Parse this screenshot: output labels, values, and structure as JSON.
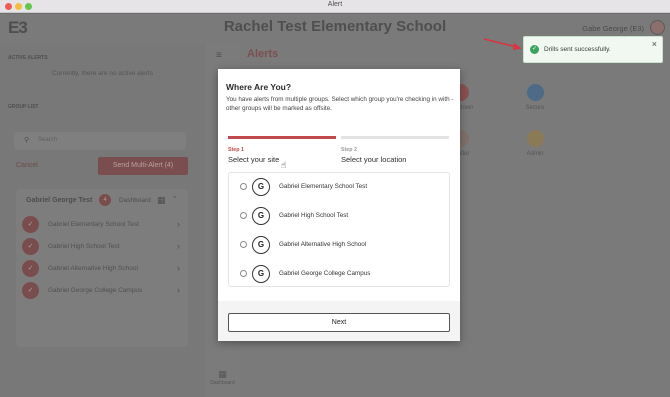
{
  "window": {
    "title": "Alert"
  },
  "header": {
    "logo": "E3",
    "school_name": "Rachel Test Elementary School",
    "user_name": "Gabe George (E3)"
  },
  "sidebar": {
    "active_alerts_title": "ACTIVE ALERTS",
    "no_alerts_text": "Currently, there are no active alerts",
    "group_list_title": "GROUP LIST",
    "search_placeholder": "Search",
    "cancel_label": "Cancel",
    "multi_alert_label": "Send Multi-Alert (4)",
    "group": {
      "name": "Gabriel George Test",
      "count": "4",
      "dashboard_label": "Dashboard",
      "items": [
        "Gabriel Elementary School Test",
        "Gabriel High School Test",
        "Gabriel Alternative High School",
        "Gabriel George College Campus"
      ]
    }
  },
  "main": {
    "alerts_title": "Alerts",
    "quick_actions": [
      "Lockdown",
      "Secure",
      "Shelter",
      "Admin"
    ],
    "dashboard_label": "Dashboard"
  },
  "modal": {
    "title": "Where Are You?",
    "description": "You have alerts from multiple groups. Select which group you're checking in with - other groups will be marked as offsite.",
    "steps": [
      {
        "number": "Step 1",
        "label": "Select your site"
      },
      {
        "number": "Step 2",
        "label": "Select your location"
      }
    ],
    "sites": [
      {
        "badge": "G",
        "name": "Gabriel Elementary School Test"
      },
      {
        "badge": "G",
        "name": "Gabriel High School Test"
      },
      {
        "badge": "G",
        "name": "Gabriel Alternative High School"
      },
      {
        "badge": "G",
        "name": "Gabriel George College Campus"
      }
    ],
    "next_label": "Next"
  },
  "toast": {
    "message": "Drills sent successfully."
  },
  "colors": {
    "accent": "#c0494b",
    "success": "#3aa55c",
    "arrow": "#d9363e"
  }
}
